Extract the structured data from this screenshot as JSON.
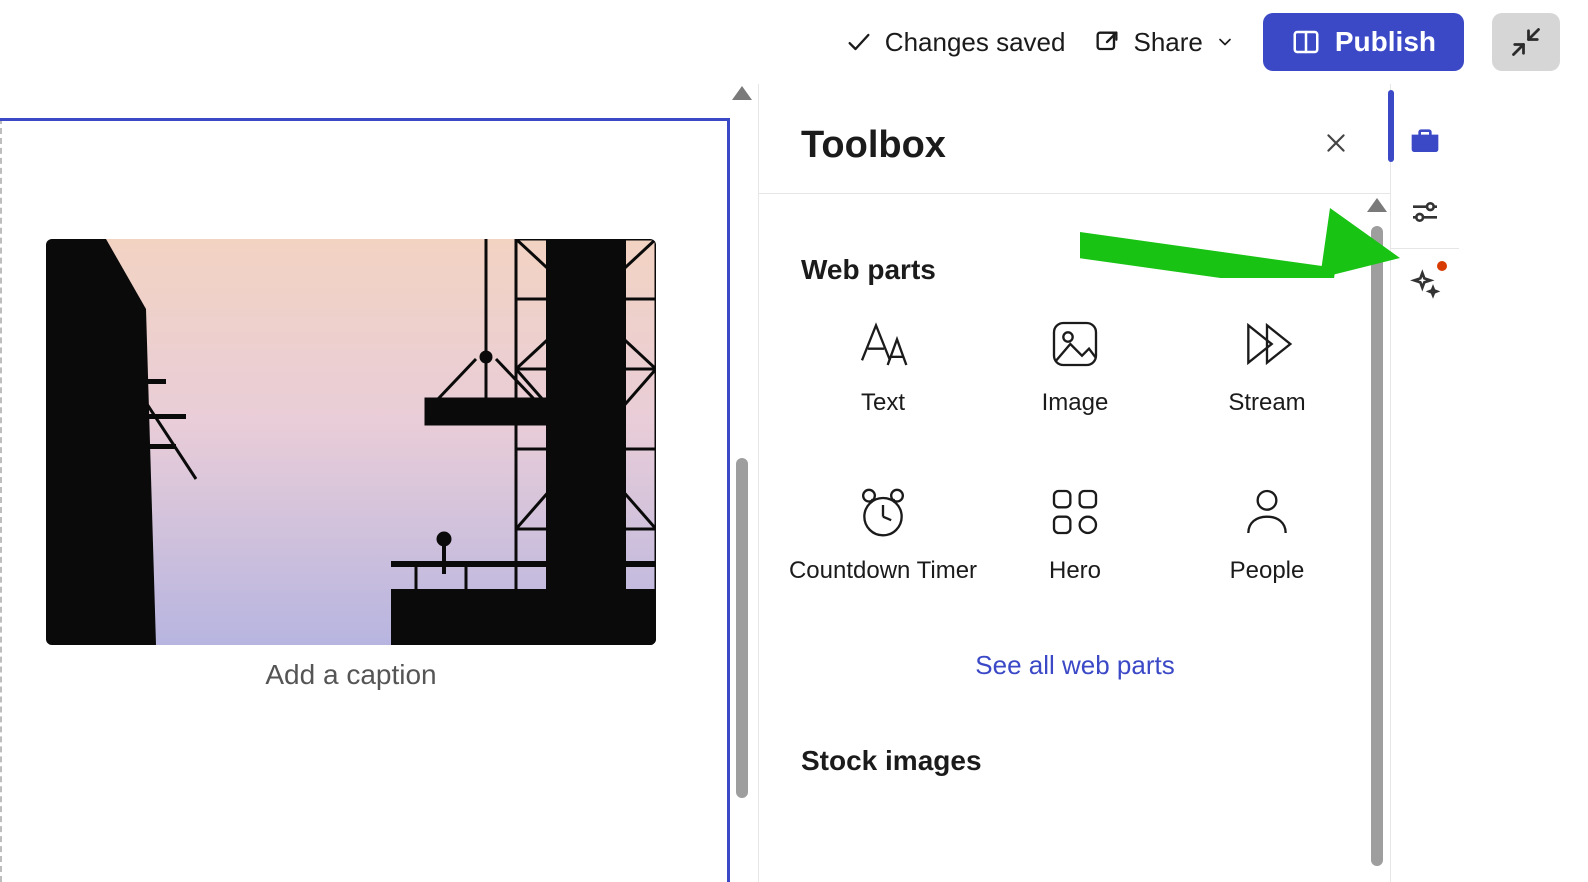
{
  "commandBar": {
    "status": "Changes saved",
    "share": "Share",
    "publish": "Publish"
  },
  "editor": {
    "captionPlaceholder": "Add a caption"
  },
  "toolbox": {
    "title": "Toolbox",
    "sectionWebParts": "Web parts",
    "seeAllLink": "See all web parts",
    "sectionStockImages": "Stock images",
    "webParts": [
      {
        "id": "text",
        "label": "Text",
        "icon": "text-icon"
      },
      {
        "id": "image",
        "label": "Image",
        "icon": "image-icon"
      },
      {
        "id": "stream",
        "label": "Stream",
        "icon": "stream-icon"
      },
      {
        "id": "countdown",
        "label": "Countdown Timer",
        "icon": "clock-icon"
      },
      {
        "id": "hero",
        "label": "Hero",
        "icon": "tiles-icon"
      },
      {
        "id": "people",
        "label": "People",
        "icon": "person-icon"
      }
    ]
  },
  "rail": {
    "items": [
      {
        "id": "toolbox",
        "icon": "toolbox-icon",
        "active": true
      },
      {
        "id": "settings",
        "icon": "sliders-icon",
        "active": false
      },
      {
        "id": "suggest",
        "icon": "sparkle-icon",
        "active": false,
        "badge": true
      }
    ]
  },
  "colors": {
    "brand": "#3b49c7",
    "annotationArrow": "#18c314"
  }
}
